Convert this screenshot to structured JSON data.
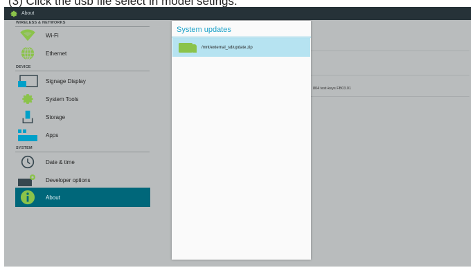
{
  "caption": "(3) Click the usb file select in model setings.",
  "app": {
    "title": "About",
    "sections": [
      {
        "header": "WIRELESS & NETWORKS",
        "items": [
          {
            "label": "Wi-Fi",
            "icon": "wifi-icon"
          },
          {
            "label": "Ethernet",
            "icon": "globe-icon"
          }
        ]
      },
      {
        "header": "DEVICE",
        "items": [
          {
            "label": "Signage Display",
            "icon": "display-icon"
          },
          {
            "label": "System Tools",
            "icon": "gear-icon"
          },
          {
            "label": "Storage",
            "icon": "storage-icon"
          },
          {
            "label": "Apps",
            "icon": "apps-icon"
          }
        ]
      },
      {
        "header": "SYSTEM",
        "items": [
          {
            "label": "Date & time",
            "icon": "clock-icon"
          },
          {
            "label": "Developer options",
            "icon": "developer-icon"
          },
          {
            "label": "About",
            "icon": "info-icon",
            "selected": true
          }
        ]
      }
    ],
    "build_text": "804 test-keys FB03.01"
  },
  "dialog": {
    "title": "System updates",
    "files": [
      {
        "name": "/mnt/external_sd/update.zip",
        "icon": "sd-card-icon",
        "selected": true
      }
    ]
  },
  "colors": {
    "accent": "#1aa1c8",
    "selected_item": "#00677a",
    "selected_file": "#b6e3f1",
    "icon_green": "#8bc34a"
  }
}
